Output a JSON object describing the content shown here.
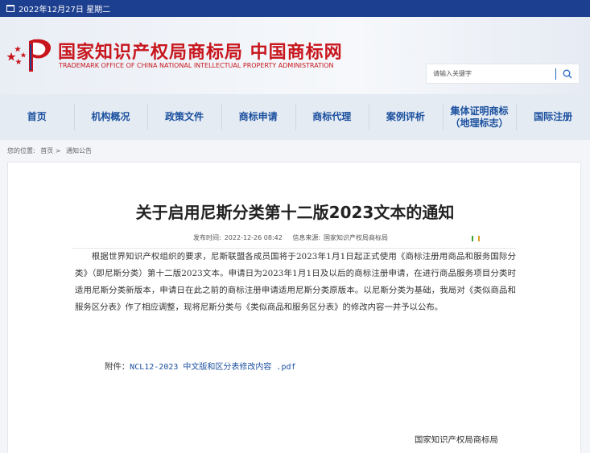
{
  "topbar": {
    "date": "2022年12月27日 星期二"
  },
  "header": {
    "title": "国家知识产权局商标局 中国商标网",
    "subtitle": "TRADEMARK OFFICE OF CHINA NATIONAL INTELLECTUAL PROPERTY ADMINISTRATION"
  },
  "search": {
    "placeholder": "请输入关键字"
  },
  "nav": {
    "items": [
      "首页",
      "机构概况",
      "政策文件",
      "商标申请",
      "商标代理",
      "案例评析",
      "集体证明商标\n（地理标志）",
      "国际注册"
    ]
  },
  "breadcrumb": {
    "label": "您的位置:",
    "home": "首页 >",
    "current": "通知公告"
  },
  "article": {
    "title": "关于启用尼斯分类第十二版2023文本的通知",
    "publish_label": "发布时间:",
    "publish_time": "2022-12-26 08:42",
    "source_label": "信息来源:",
    "source": "国家知识产权局商标局",
    "body": "根据世界知识产权组织的要求，尼斯联盟各成员国将于2023年1月1日起正式使用《商标注册用商品和服务国际分类》（即尼斯分类）第十二版2023文本。申请日为2023年1月1日及以后的商标注册申请，在进行商品服务项目分类时适用尼斯分类新版本，申请日在此之前的商标注册申请适用尼斯分类原版本。以尼斯分类为基础，我局对《类似商品和服务区分表》作了相应调整，现将尼斯分类与《类似商品和服务区分表》的修改内容一并予以公布。",
    "attachment_label": "附件：",
    "attachment_link": "NCL12-2023 中文版和区分表修改内容 .pdf",
    "signature": "国家知识产权局商标局"
  },
  "colors": {
    "brand_red": "#c8161d",
    "nav_blue": "#1a4f9e",
    "topbar": "#1d3f8f"
  }
}
